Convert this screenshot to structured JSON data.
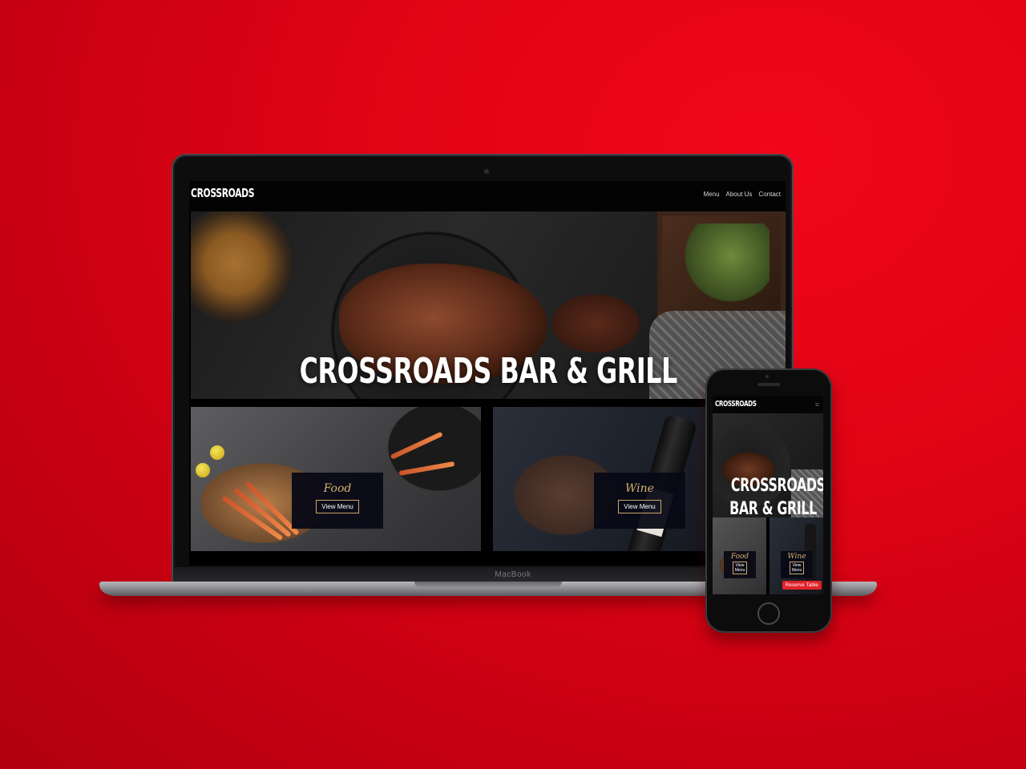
{
  "desktop": {
    "logo": "CROSSROADS",
    "nav": [
      "Menu",
      "About Us",
      "Contact"
    ],
    "hero_title": "CROSSROADS BAR & GRILL",
    "tiles": [
      {
        "title": "Food",
        "button": "View Menu"
      },
      {
        "title": "Wine",
        "button": "View Menu"
      }
    ],
    "device_label": "MacBook"
  },
  "mobile": {
    "logo": "CROSSROADS",
    "hero_title_line1": "CROSSROADS",
    "hero_title_line2": "BAR & GRILL",
    "tiles": [
      {
        "title": "Food",
        "button_line1": "View",
        "button_line2": "Menu"
      },
      {
        "title": "Wine",
        "button_line1": "View",
        "button_line2": "Menu"
      }
    ],
    "reserve_button": "Reserve Table"
  },
  "colors": {
    "background_red": "#e10415",
    "accent_gold": "#d3b06a",
    "reserve_red": "#e0222a"
  }
}
